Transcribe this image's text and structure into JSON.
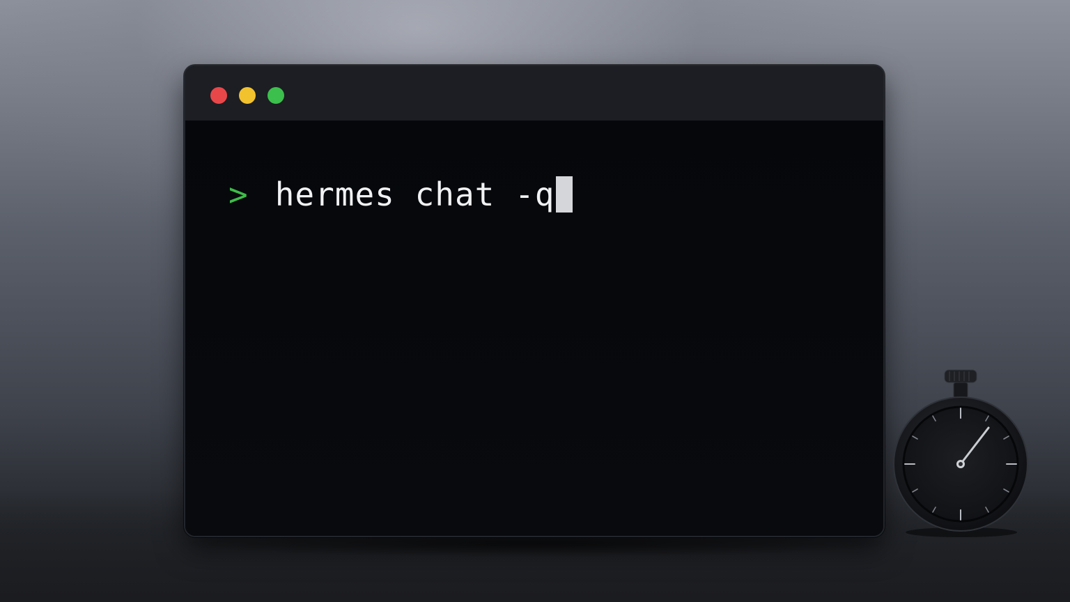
{
  "terminal": {
    "window_controls": [
      {
        "name": "close",
        "color": "#e8474a"
      },
      {
        "name": "minimize",
        "color": "#f2c12e"
      },
      {
        "name": "maximize",
        "color": "#3cbf4c"
      }
    ],
    "prompt_symbol": ">",
    "prompt_color": "#3fbb4a",
    "command": "hermes chat -q",
    "cursor": "block"
  },
  "decor": {
    "stopwatch_icon": "stopwatch-icon"
  }
}
